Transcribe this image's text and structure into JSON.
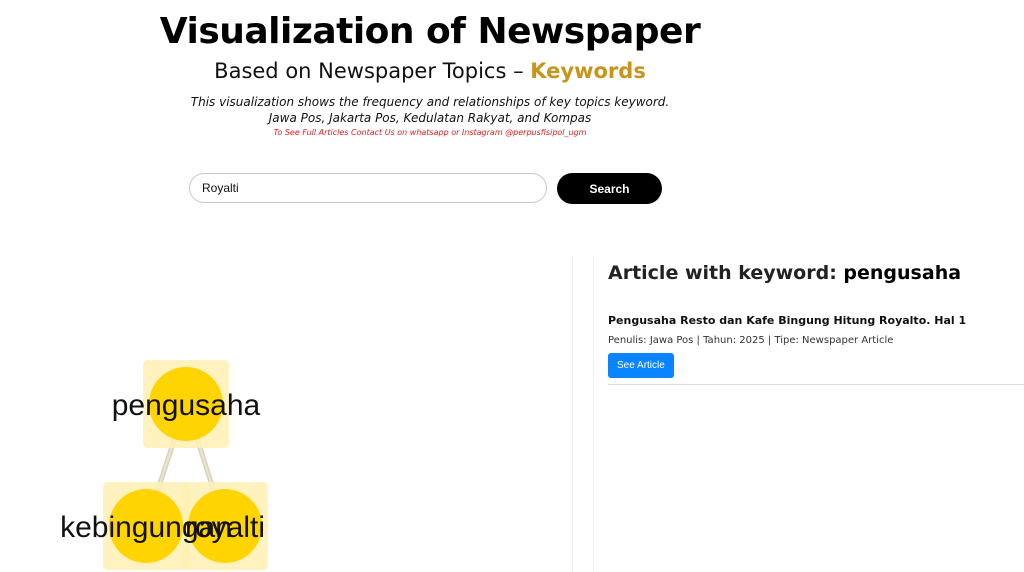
{
  "header": {
    "title": "Visualization of Newspaper",
    "subtitle_prefix": "Based on Newspaper Topics – ",
    "subtitle_keyword": "Keywords",
    "description_line1": "This visualization shows the frequency and relationships of key topics keyword.",
    "description_line2": "Jawa Pos, Jakarta Pos, Kedulatan Rakyat, and Kompas",
    "contact": "To See Full Articles Contact Us on whatsapp or Instagram @perpusfisipol_ugm"
  },
  "search": {
    "value": "Royalti",
    "button_label": "Search"
  },
  "graph": {
    "nodes": [
      {
        "id": "pengusaha",
        "label": "pengusaha"
      },
      {
        "id": "kebingungan",
        "label": "kebingungan"
      },
      {
        "id": "royalti",
        "label": "royalti"
      }
    ],
    "edges": [
      {
        "source": "pengusaha",
        "target": "kebingungan"
      },
      {
        "source": "pengusaha",
        "target": "royalti"
      }
    ],
    "colors": {
      "node": "#ffd400",
      "node_halo": "#fff0b3",
      "edge": "#d8d2bf"
    }
  },
  "articles": {
    "heading_prefix": "Article with keyword: ",
    "heading_keyword": "pengusaha",
    "items": [
      {
        "title": "Pengusaha Resto dan Kafe Bingung Hitung Royalto. Hal 1",
        "meta": "Penulis: Jawa Pos | Tahun: 2025 | Tipe: Newspaper Article",
        "button_label": "See Article"
      }
    ]
  },
  "colors": {
    "keyword_accent": "#c8951a",
    "contact_text": "#e02020",
    "see_article_button": "#0a84ff",
    "search_button": "#000000"
  }
}
